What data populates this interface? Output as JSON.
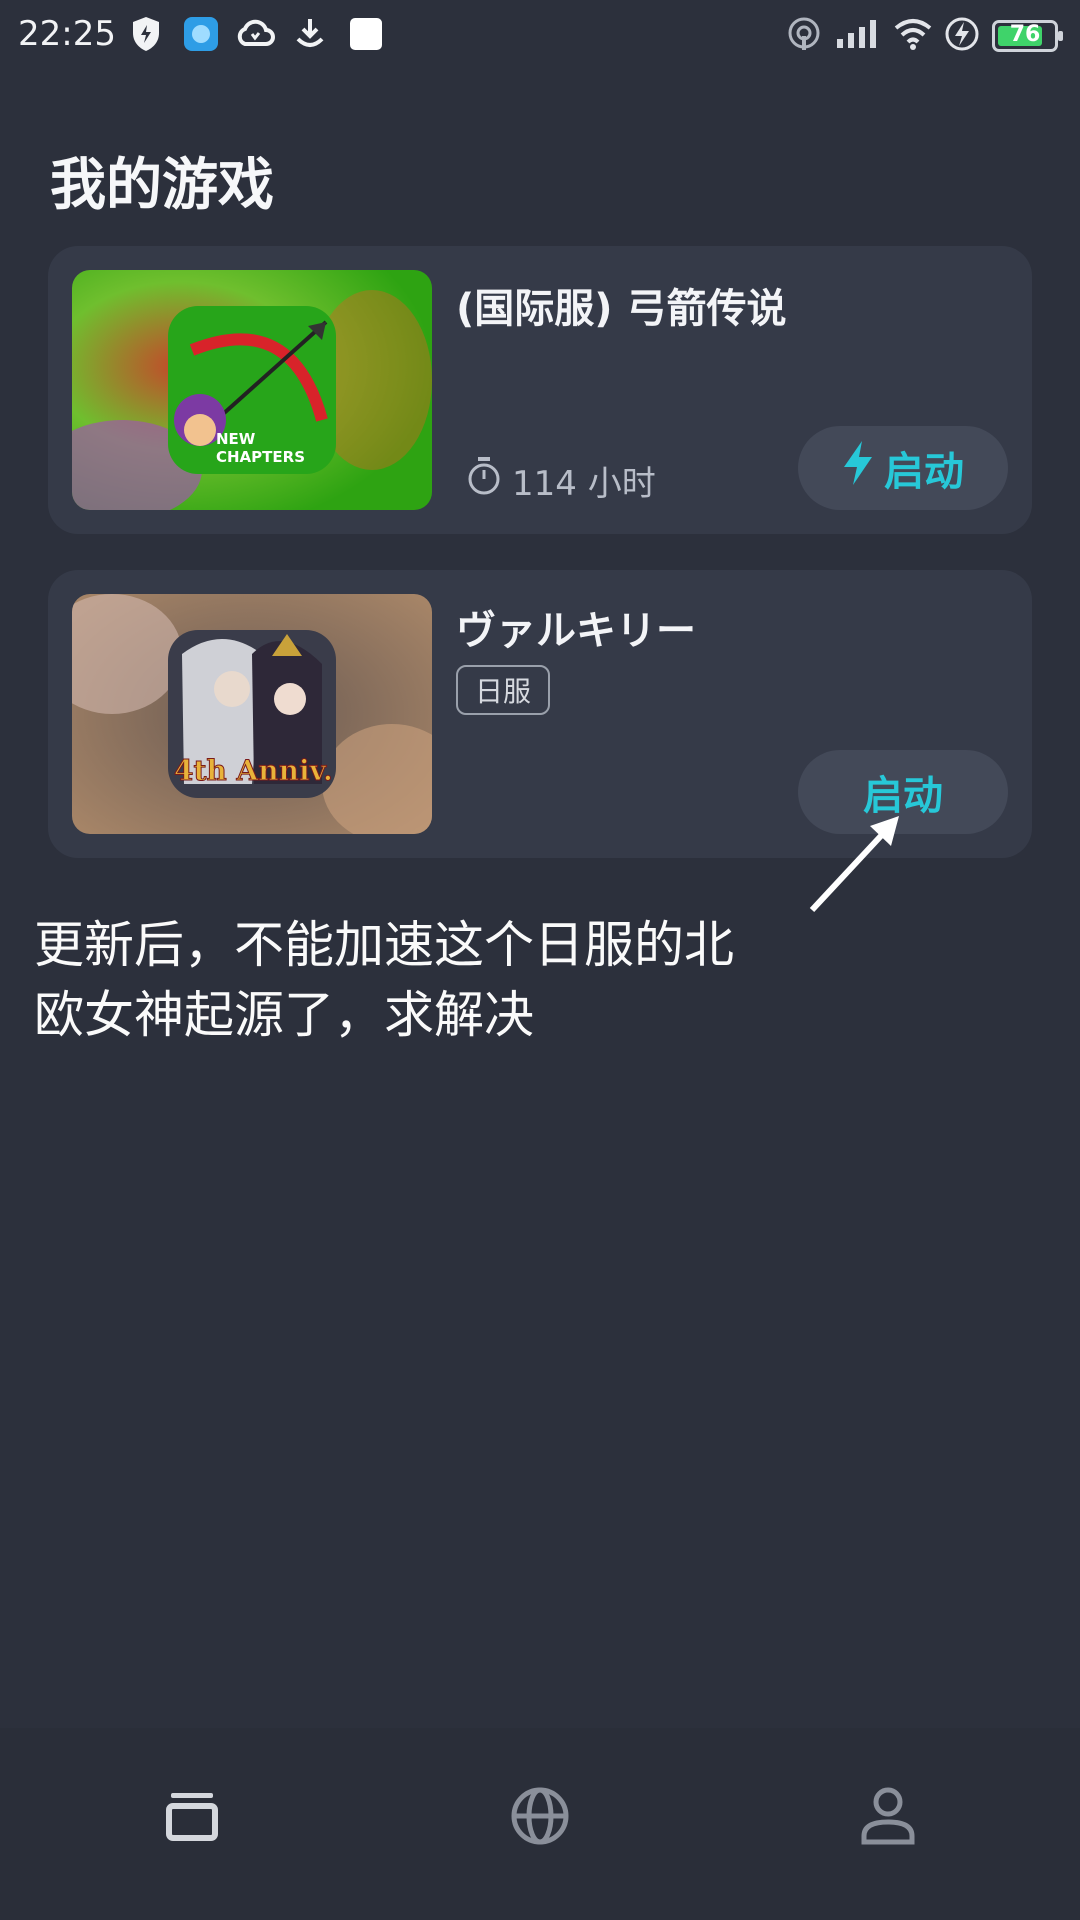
{
  "status_bar": {
    "time": "22:25",
    "battery_level": "76",
    "left_icons": [
      "shield-icon",
      "app-icon",
      "cloud-icon",
      "download-icon",
      "white-square-icon"
    ],
    "right_icons": [
      "hotspot-icon",
      "signal-icon",
      "wifi-icon",
      "charging-icon",
      "battery-icon"
    ]
  },
  "page": {
    "title": "我的游戏"
  },
  "games": [
    {
      "name": "(国际服) 弓箭传说",
      "playtime": "114 小时",
      "thumb_text": [
        "NEW",
        "CHAPTERS"
      ],
      "launch_label": "启动",
      "launch_icon": "lightning-icon"
    },
    {
      "name": "ヴァルキリー",
      "region": "日服",
      "thumb_text": "4th Anniv.",
      "launch_label": "启动"
    }
  ],
  "annotation": {
    "line1": "更新后，不能加速这个日服的北",
    "line2": "欧女神起源了，求解决"
  },
  "tab_bar": {
    "tabs": [
      "games-tab-icon",
      "globe-icon",
      "profile-icon"
    ],
    "active_index": 0
  },
  "colors": {
    "background": "#2c303c",
    "card": "#353a48",
    "accent": "#27c8d8",
    "button_bg": "#434958"
  }
}
